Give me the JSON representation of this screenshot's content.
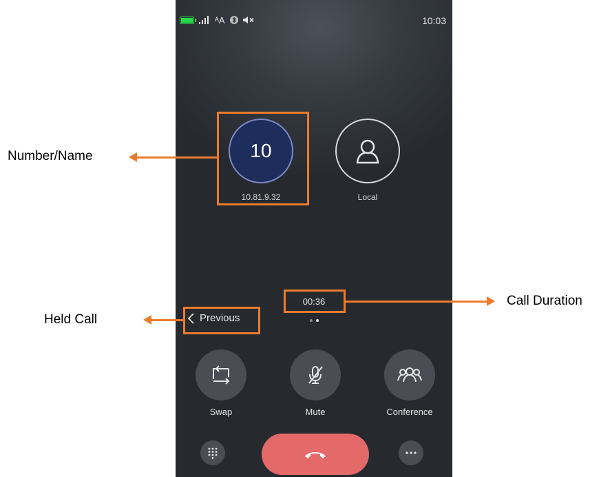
{
  "status_bar": {
    "time": "10:03",
    "font_glyph": "ᴬA",
    "icons": [
      "battery-icon",
      "signal-icon",
      "font-size-icon",
      "bluetooth-icon",
      "muted-speaker-icon"
    ]
  },
  "call": {
    "remote_avatar_text": "10",
    "remote_address": "10.81.9.32",
    "local_label": "Local",
    "duration": "00:36",
    "previous_label": "Previous"
  },
  "actions": [
    {
      "label": "Swap",
      "icon": "swap-icon"
    },
    {
      "label": "Mute",
      "icon": "mic-muted-icon"
    },
    {
      "label": "Conference",
      "icon": "conference-icon"
    }
  ],
  "bottom_controls": {
    "dialpad_icon": "dialpad-icon",
    "end_call_icon": "hangup-icon",
    "more_icon": "more-icon"
  },
  "annotations": {
    "number_name": "Number/Name",
    "held_call": "Held Call",
    "call_duration": "Call Duration",
    "accent_color": "#ed7b2c"
  },
  "colors": {
    "end_call": "#e46a6a",
    "remote_avatar": "#1e2e5c",
    "battery": "#29d84a"
  }
}
